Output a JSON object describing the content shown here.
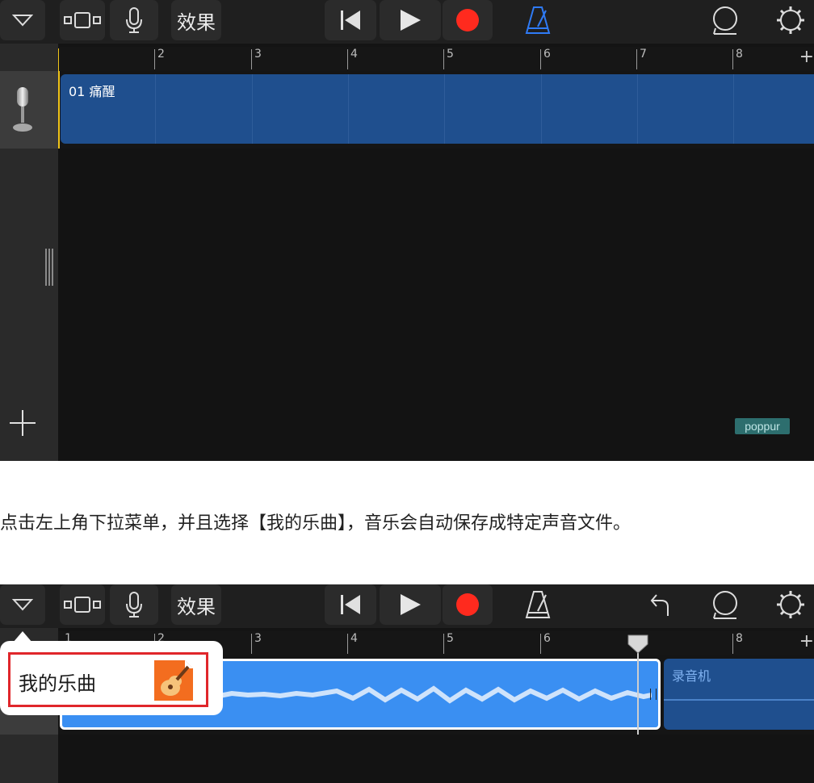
{
  "screenshot_top": {
    "toolbar": {
      "menu_icon": "chevron-down-icon",
      "tracks_view_icon": "tracks-view-icon",
      "mic_icon": "microphone-icon",
      "effects_label": "效果",
      "rewind_icon": "rewind-icon",
      "play_icon": "play-icon",
      "record_icon": "record-icon",
      "metronome_icon": "metronome-icon",
      "loop_icon": "loop-icon",
      "settings_icon": "gear-icon"
    },
    "ruler_numbers": [
      "2",
      "3",
      "4",
      "5",
      "6",
      "7",
      "8"
    ],
    "track": {
      "instrument_icon": "microphone-instrument-icon",
      "region_label": "01 痛醒"
    },
    "add_track_icon": "plus-icon",
    "watermark": "poppur"
  },
  "caption": "点击左上角下拉菜单，并且选择【我的乐曲】，音乐会自动保存成特定声音文件。",
  "screenshot_bottom": {
    "toolbar": {
      "effects_label": "效果",
      "undo_icon": "undo-icon"
    },
    "ruler_numbers": [
      "1",
      "2",
      "3",
      "4",
      "5",
      "6",
      "8"
    ],
    "popup": {
      "my_songs_label": "我的乐曲",
      "app_icon": "garageband-icon"
    },
    "second_region_label": "录音机"
  },
  "colors": {
    "record": "#ff2a1e",
    "region_dark": "#1f4f8e",
    "region_bright": "#3a8ff2",
    "metronome_active": "#2f7bf6",
    "highlight_box": "#e0262b"
  }
}
